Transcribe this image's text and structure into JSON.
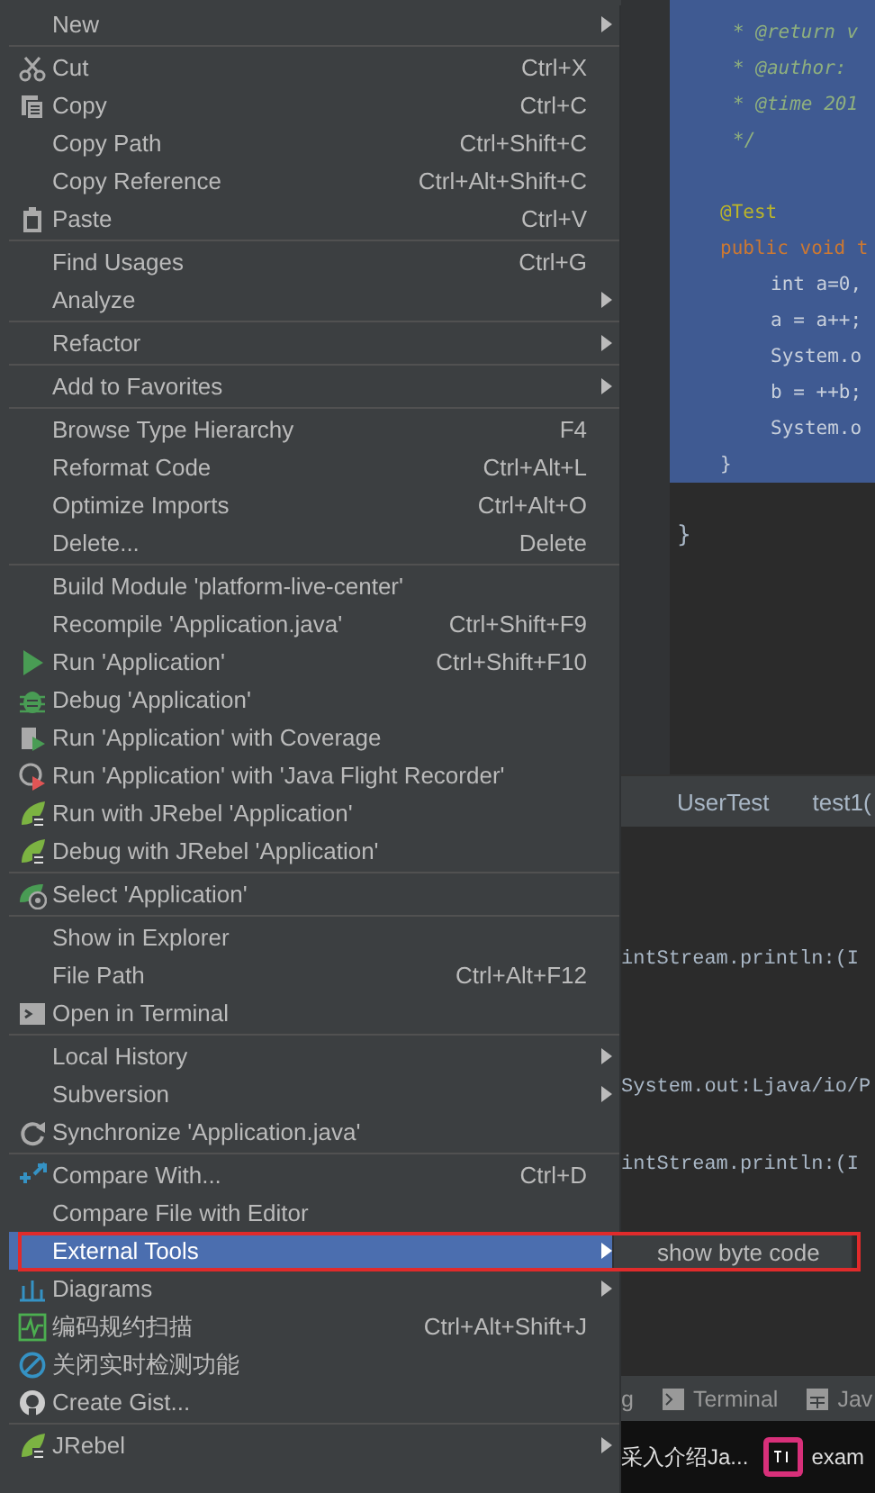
{
  "editor": {
    "code_lines": [
      {
        "kind": "doc",
        "text": "* @return v"
      },
      {
        "kind": "doc",
        "text": "* @author: "
      },
      {
        "kind": "doc",
        "text": "* @time 201"
      },
      {
        "kind": "doc",
        "text": "*/"
      },
      {
        "kind": "annotation",
        "text": "@Test"
      },
      {
        "kind": "signature",
        "text": "public void t"
      },
      {
        "kind": "body",
        "text": "int a=0,"
      },
      {
        "kind": "body",
        "text": "a = a++;"
      },
      {
        "kind": "body",
        "text": "System.o"
      },
      {
        "kind": "body",
        "text": "b = ++b;"
      },
      {
        "kind": "body",
        "text": "System.o"
      },
      {
        "kind": "close",
        "text": "}"
      }
    ],
    "closing_brace": "}"
  },
  "breadcrumbs": [
    "UserTest",
    "test1("
  ],
  "console": {
    "lines": [
      "intStream.println:(I",
      "System.out:Ljava/io/P",
      "intStream.println:(I"
    ]
  },
  "tool_window_bar": {
    "items": [
      {
        "label": "g",
        "kind": "plain"
      },
      {
        "label": "Terminal",
        "kind": "terminal"
      },
      {
        "label": "Jav",
        "kind": "table"
      }
    ]
  },
  "taskbar": {
    "items": [
      {
        "label": "采入介绍Ja...",
        "kind": "plain"
      },
      {
        "label": "exam",
        "kind": "ide"
      }
    ]
  },
  "menu": {
    "groups": [
      {
        "items": [
          {
            "label": "New",
            "submenu": true,
            "selected": false
          }
        ]
      },
      {
        "items": [
          {
            "label": "Cut",
            "shortcut": "Ctrl+X",
            "submenu": false,
            "selected": false
          },
          {
            "label": "Copy",
            "shortcut": "Ctrl+C",
            "submenu": false,
            "selected": false
          },
          {
            "label": "Copy Path",
            "shortcut": "Ctrl+Shift+C",
            "submenu": false,
            "selected": false
          },
          {
            "label": "Copy Reference",
            "shortcut": "Ctrl+Alt+Shift+C",
            "submenu": false,
            "selected": false
          },
          {
            "label": "Paste",
            "shortcut": "Ctrl+V",
            "submenu": false,
            "selected": false
          }
        ]
      },
      {
        "items": [
          {
            "label": "Find Usages",
            "shortcut": "Ctrl+G",
            "submenu": false,
            "selected": false
          },
          {
            "label": "Analyze",
            "submenu": true,
            "selected": false
          }
        ]
      },
      {
        "items": [
          {
            "label": "Refactor",
            "submenu": true,
            "selected": false
          }
        ]
      },
      {
        "items": [
          {
            "label": "Add to Favorites",
            "submenu": true,
            "selected": false
          }
        ]
      },
      {
        "items": [
          {
            "label": "Browse Type Hierarchy",
            "shortcut": "F4",
            "submenu": false,
            "selected": false
          },
          {
            "label": "Reformat Code",
            "shortcut": "Ctrl+Alt+L",
            "submenu": false,
            "selected": false
          },
          {
            "label": "Optimize Imports",
            "shortcut": "Ctrl+Alt+O",
            "submenu": false,
            "selected": false
          },
          {
            "label": "Delete...",
            "shortcut": "Delete",
            "submenu": false,
            "selected": false
          }
        ]
      },
      {
        "items": [
          {
            "label": "Build Module 'platform-live-center'",
            "submenu": false,
            "selected": false
          },
          {
            "label": "Recompile 'Application.java'",
            "shortcut": "Ctrl+Shift+F9",
            "submenu": false,
            "selected": false
          },
          {
            "label": "Run 'Application'",
            "shortcut": "Ctrl+Shift+F10",
            "submenu": false,
            "selected": false
          },
          {
            "label": "Debug 'Application'",
            "submenu": false,
            "selected": false
          },
          {
            "label": "Run 'Application' with Coverage",
            "submenu": false,
            "selected": false
          },
          {
            "label": "Run 'Application' with 'Java Flight Recorder'",
            "submenu": false,
            "selected": false
          },
          {
            "label": "Run with JRebel 'Application'",
            "submenu": false,
            "selected": false
          },
          {
            "label": "Debug with JRebel 'Application'",
            "submenu": false,
            "selected": false
          }
        ]
      },
      {
        "items": [
          {
            "label": "Select 'Application'",
            "submenu": false,
            "selected": false
          }
        ]
      },
      {
        "items": [
          {
            "label": "Show in Explorer",
            "submenu": false,
            "selected": false
          },
          {
            "label": "File Path",
            "shortcut": "Ctrl+Alt+F12",
            "submenu": false,
            "selected": false
          },
          {
            "label": "Open in Terminal",
            "submenu": false,
            "selected": false
          }
        ]
      },
      {
        "items": [
          {
            "label": "Local History",
            "submenu": true,
            "selected": false
          },
          {
            "label": "Subversion",
            "submenu": true,
            "selected": false
          },
          {
            "label": "Synchronize 'Application.java'",
            "submenu": false,
            "selected": false
          }
        ]
      },
      {
        "items": [
          {
            "label": "Compare With...",
            "shortcut": "Ctrl+D",
            "submenu": false,
            "selected": false
          },
          {
            "label": "Compare File with Editor",
            "submenu": false,
            "selected": false
          },
          {
            "label": "External Tools",
            "submenu": true,
            "selected": true
          },
          {
            "label": "Diagrams",
            "submenu": true,
            "selected": false
          },
          {
            "label": "编码规约扫描",
            "shortcut": "Ctrl+Alt+Shift+J",
            "submenu": false,
            "selected": false
          },
          {
            "label": "关闭实时检测功能",
            "submenu": false,
            "selected": false
          },
          {
            "label": "Create Gist...",
            "submenu": false,
            "selected": false
          }
        ]
      },
      {
        "items": [
          {
            "label": "JRebel",
            "submenu": true,
            "selected": false
          }
        ]
      }
    ]
  },
  "submenu": {
    "items": [
      {
        "label": "show byte code"
      }
    ]
  }
}
